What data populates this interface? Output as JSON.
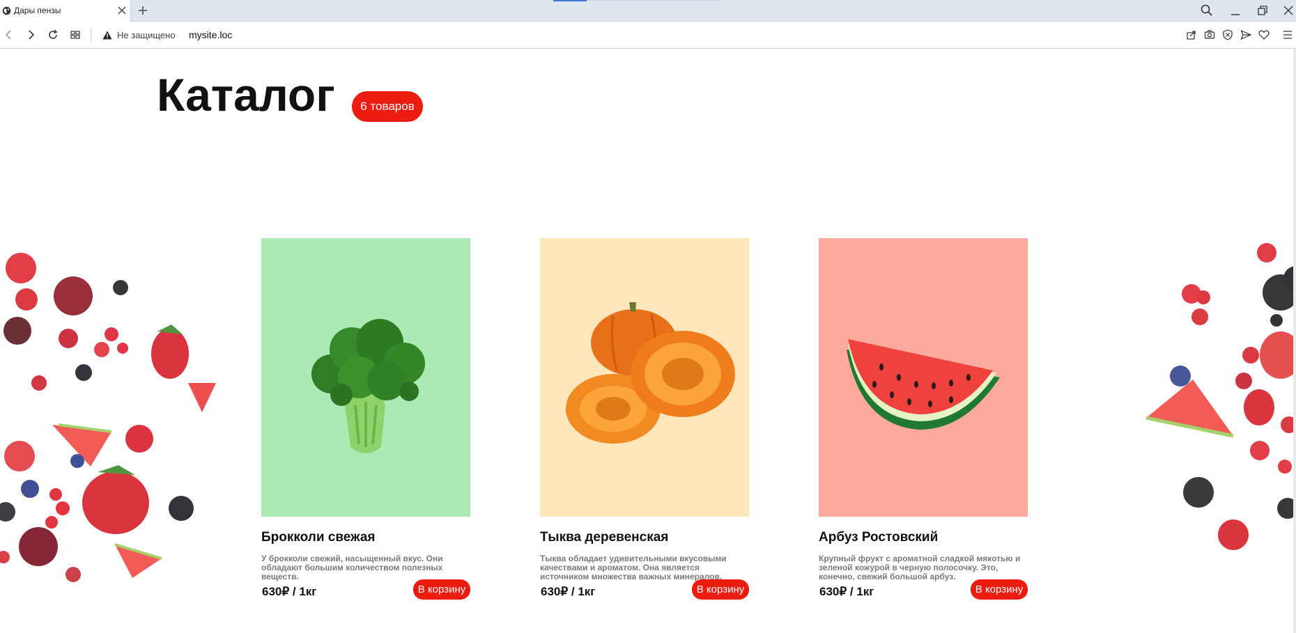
{
  "browser": {
    "tab_title": "Дары пензы",
    "security_text": "Не защищено",
    "url": "mysite.loc"
  },
  "page": {
    "title": "Каталог",
    "count_badge": "6 товаров"
  },
  "products": [
    {
      "name": "Брокколи свежая",
      "description": "У брокколи свежий, насыщенный вкус. Они обладают большим количеством полезных веществ.",
      "price": "630₽ / 1кг",
      "button": "В корзину",
      "bg_color": "#abeab5"
    },
    {
      "name": "Тыква деревенская",
      "description": "Тыква обладает удивительными вкусовыми качествами и ароматом. Она является источником множества важных минералов.",
      "price": "630₽ / 1кг",
      "button": "В корзину",
      "bg_color": "#fde5bc"
    },
    {
      "name": "Арбуз Ростовский",
      "description": "Крупный фрукт с ароматной сладкой мякотью и зеленой кожурой в черную полосочку. Это, конечно, свежий большой арбуз.",
      "price": "630₽ / 1кг",
      "button": "В корзину",
      "bg_color": "#fda99e"
    }
  ],
  "colors": {
    "accent": "#ee1b10",
    "chrome": "#dfe6ef"
  },
  "icons": {
    "tab_favicon": "globe-icon",
    "close": "close-icon",
    "new_tab": "plus-icon",
    "back": "back-arrow-icon",
    "forward": "forward-arrow-icon",
    "reload": "reload-icon",
    "tiles": "speed-dial-icon",
    "warning": "warning-icon",
    "share": "share-icon",
    "snapshot": "camera-icon",
    "adblock": "shield-icon",
    "send": "send-icon",
    "favorite": "heart-icon",
    "menu": "menu-icon"
  }
}
